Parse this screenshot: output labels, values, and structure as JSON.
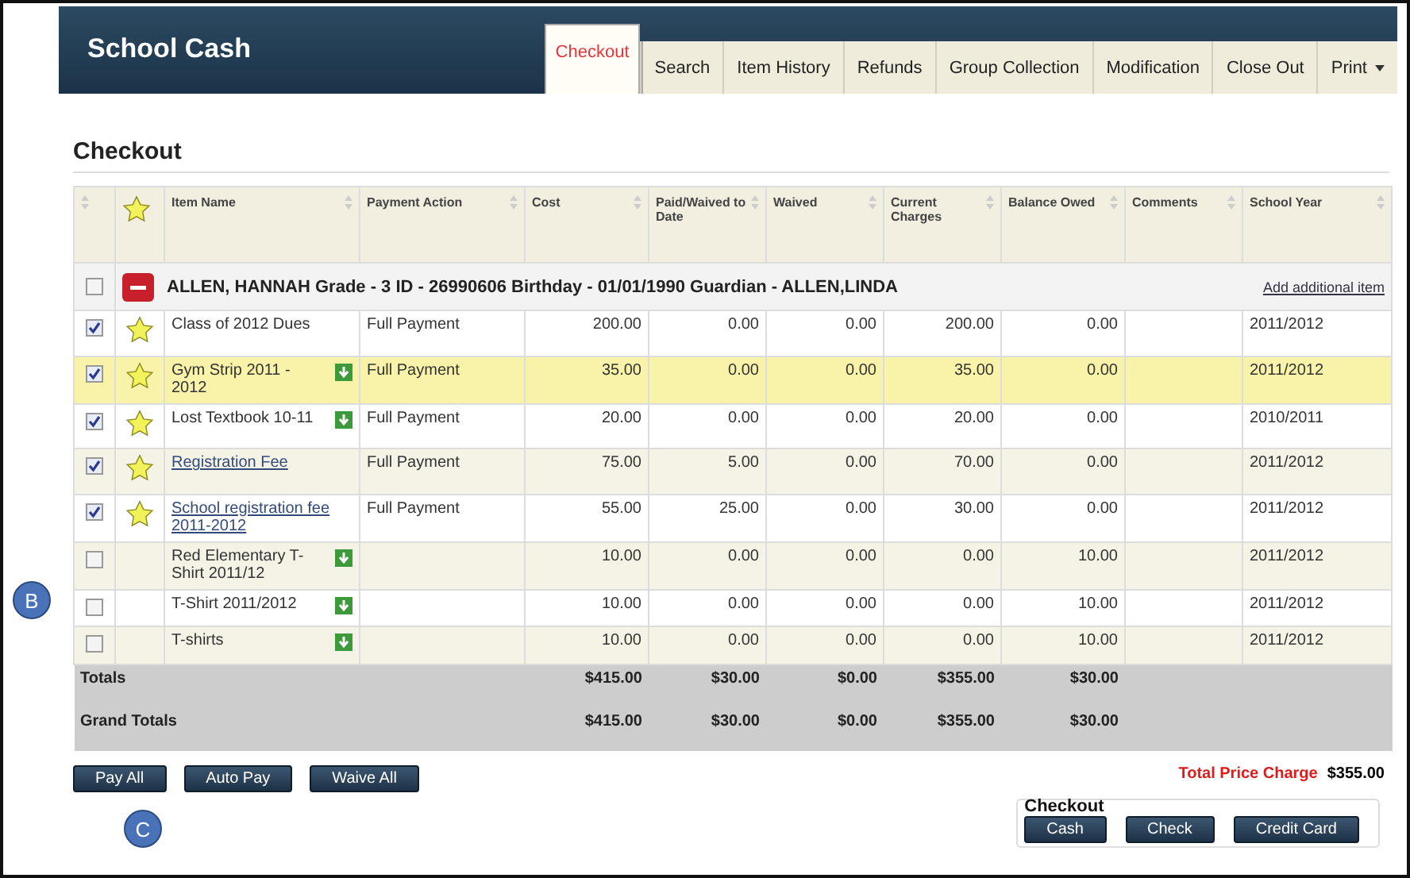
{
  "app_title": "School Cash",
  "tabs": [
    {
      "label": "Checkout",
      "selected": true,
      "kind": "tab"
    },
    {
      "label": "Search",
      "selected": false,
      "kind": "tab"
    },
    {
      "label": "Item History",
      "selected": false,
      "kind": "tab"
    },
    {
      "label": "Refunds",
      "selected": false,
      "kind": "tab"
    },
    {
      "label": "Group Collection",
      "selected": false,
      "kind": "tab"
    },
    {
      "label": "Modification",
      "selected": false,
      "kind": "tab"
    },
    {
      "label": "Close Out",
      "selected": false,
      "kind": "tab"
    },
    {
      "label": "Print",
      "selected": false,
      "kind": "menu"
    }
  ],
  "page_title": "Checkout",
  "table": {
    "columns": [
      "Item Name",
      "Payment Action",
      "Cost",
      "Paid/Waived to Date",
      "Waived",
      "Current Charges",
      "Balance Owed",
      "Comments",
      "School Year"
    ],
    "group": {
      "checked": false,
      "text": "ALLEN, HANNAH Grade - 3 ID - 26990606 Birthday - 01/01/1990 Guardian - ALLEN,LINDA",
      "link": "Add additional item"
    },
    "rows": [
      {
        "checked": true,
        "starred": true,
        "name": "Class of 2012 Dues",
        "link": false,
        "download": false,
        "action": "Full Payment",
        "values": [
          "200.00",
          "0.00",
          "0.00",
          "200.00",
          "0.00"
        ],
        "year": "2011/2012",
        "selected": false
      },
      {
        "checked": true,
        "starred": true,
        "name": "Gym Strip 2011 - 2012",
        "link": false,
        "download": true,
        "action": "Full Payment",
        "values": [
          "35.00",
          "0.00",
          "0.00",
          "35.00",
          "0.00"
        ],
        "year": "2011/2012",
        "selected": true
      },
      {
        "checked": true,
        "starred": true,
        "name": "Lost Textbook 10-11",
        "link": false,
        "download": true,
        "action": "Full Payment",
        "values": [
          "20.00",
          "0.00",
          "0.00",
          "20.00",
          "0.00"
        ],
        "year": "2010/2011",
        "selected": false
      },
      {
        "checked": true,
        "starred": true,
        "name": "Registration Fee",
        "link": true,
        "download": false,
        "action": "Full Payment",
        "values": [
          "75.00",
          "5.00",
          "0.00",
          "70.00",
          "0.00"
        ],
        "year": "2011/2012",
        "selected": false
      },
      {
        "checked": true,
        "starred": true,
        "name": "School registration fee 2011-2012",
        "link": true,
        "download": false,
        "action": "Full Payment",
        "values": [
          "55.00",
          "25.00",
          "0.00",
          "30.00",
          "0.00"
        ],
        "year": "2011/2012",
        "selected": false
      },
      {
        "checked": false,
        "starred": false,
        "name": "Red Elementary T-Shirt 2011/12",
        "link": false,
        "download": true,
        "values": [
          "10.00",
          "0.00",
          "0.00",
          "0.00",
          "10.00"
        ],
        "year": "2011/2012",
        "selected": false
      },
      {
        "checked": false,
        "starred": false,
        "name": "T-Shirt 2011/2012",
        "link": false,
        "download": true,
        "values": [
          "10.00",
          "0.00",
          "0.00",
          "0.00",
          "10.00"
        ],
        "year": "2011/2012",
        "selected": false
      },
      {
        "checked": false,
        "starred": false,
        "name": "T-shirts",
        "link": false,
        "download": true,
        "values": [
          "10.00",
          "0.00",
          "0.00",
          "0.00",
          "10.00"
        ],
        "year": "2011/2012",
        "selected": false
      }
    ],
    "totals": [
      {
        "label": "Totals",
        "values": [
          "$415.00",
          "$30.00",
          "$0.00",
          "$355.00",
          "$30.00"
        ]
      },
      {
        "label": "Grand Totals",
        "values": [
          "$415.00",
          "$30.00",
          "$0.00",
          "$355.00",
          "$30.00"
        ]
      }
    ]
  },
  "actions": [
    "Pay All",
    "Auto Pay",
    "Waive All"
  ],
  "total_price": {
    "label": "Total Price Charge",
    "value": "$355.00"
  },
  "checkout": {
    "title": "Checkout",
    "buttons": [
      "Cash",
      "Check",
      "Credit Card"
    ]
  },
  "callouts": [
    "B",
    "C"
  ]
}
